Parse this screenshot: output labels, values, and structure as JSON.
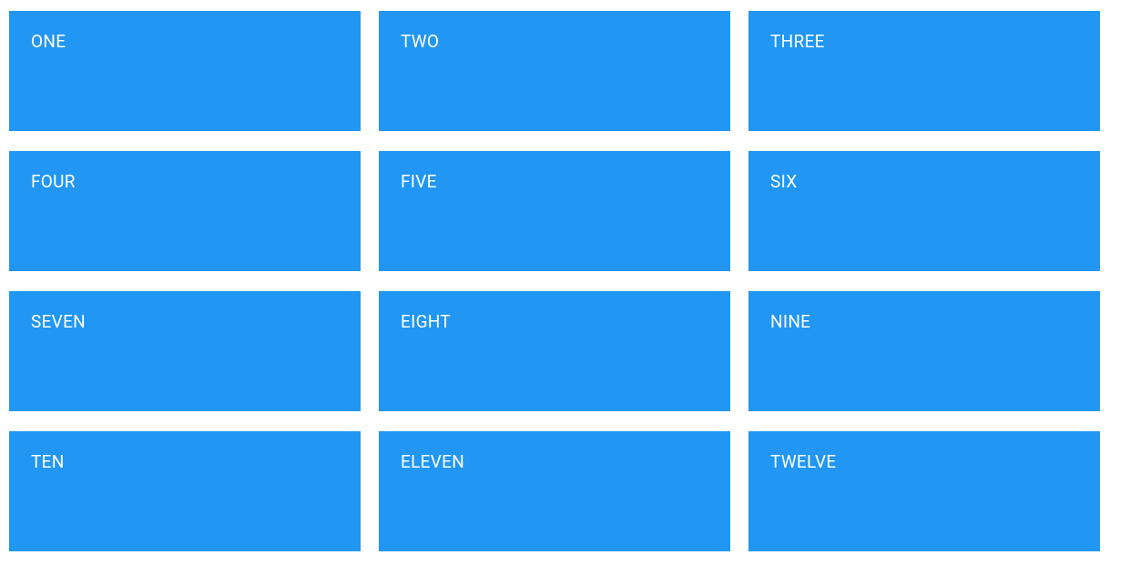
{
  "grid": {
    "cards": [
      {
        "label": "ONE"
      },
      {
        "label": "TWO"
      },
      {
        "label": "THREE"
      },
      {
        "label": "FOUR"
      },
      {
        "label": "FIVE"
      },
      {
        "label": "SIX"
      },
      {
        "label": "SEVEN"
      },
      {
        "label": "EIGHT"
      },
      {
        "label": "NINE"
      },
      {
        "label": "TEN"
      },
      {
        "label": "ELEVEN"
      },
      {
        "label": "TWELVE"
      }
    ]
  },
  "colors": {
    "card_bg": "#2196f3",
    "card_text": "#ffffff"
  }
}
